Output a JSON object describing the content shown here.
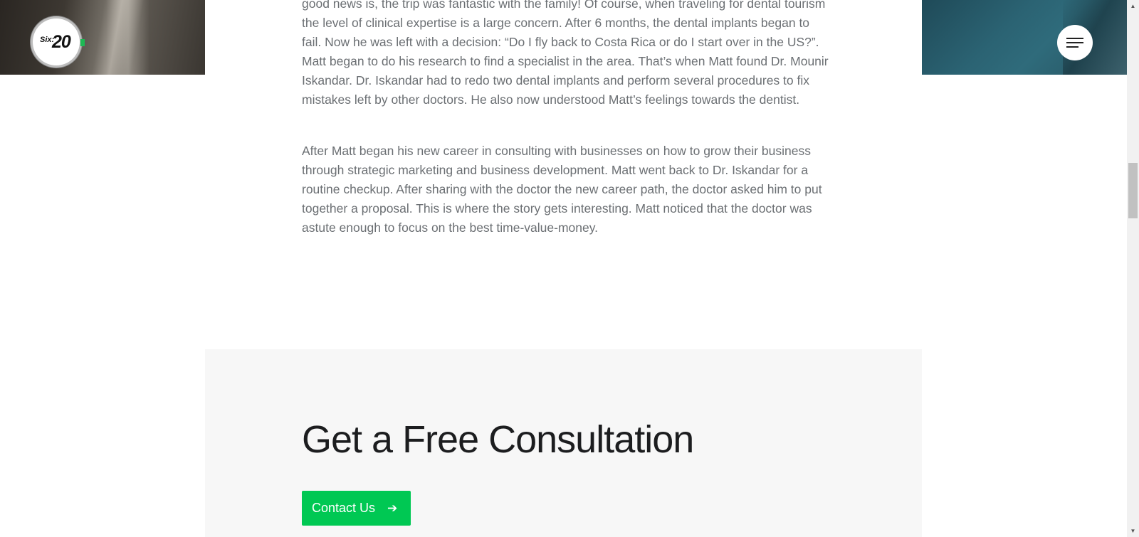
{
  "header": {
    "logo": {
      "small_text": "Six:",
      "big_text": "20",
      "accent_color": "#1db954"
    },
    "menu_icon": "hamburger-menu-icon"
  },
  "article": {
    "paragraphs": [
      "good news is, the trip was fantastic with the family! Of course, when traveling for dental tourism the level of clinical expertise is a large concern. After 6 months, the dental implants began to fail. Now he was left with a decision: “Do I fly back to Costa Rica or do I start over in the US?”. Matt began to do his research to find a specialist in the area. That’s when Matt found Dr. Mounir Iskandar. Dr. Iskandar had to redo two dental implants and perform several procedures to fix mistakes left by other doctors. He also now understood Matt’s feelings towards the dentist.",
      "After Matt began his new career in consulting with businesses on how to grow their business through strategic marketing and business development. Matt went back to Dr. Iskandar for a routine checkup. After sharing with the doctor the new career path, the doctor asked him to put together a proposal. This is where the story gets interesting. Matt noticed that the doctor was astute enough to focus on the best time-value-money."
    ]
  },
  "cta": {
    "title": "Get a Free Consultation",
    "button_label": "Contact Us",
    "button_icon": "arrow-right-icon",
    "button_color": "#00c853"
  },
  "scrollbar": {
    "up_glyph": "▲",
    "down_glyph": "▼"
  }
}
